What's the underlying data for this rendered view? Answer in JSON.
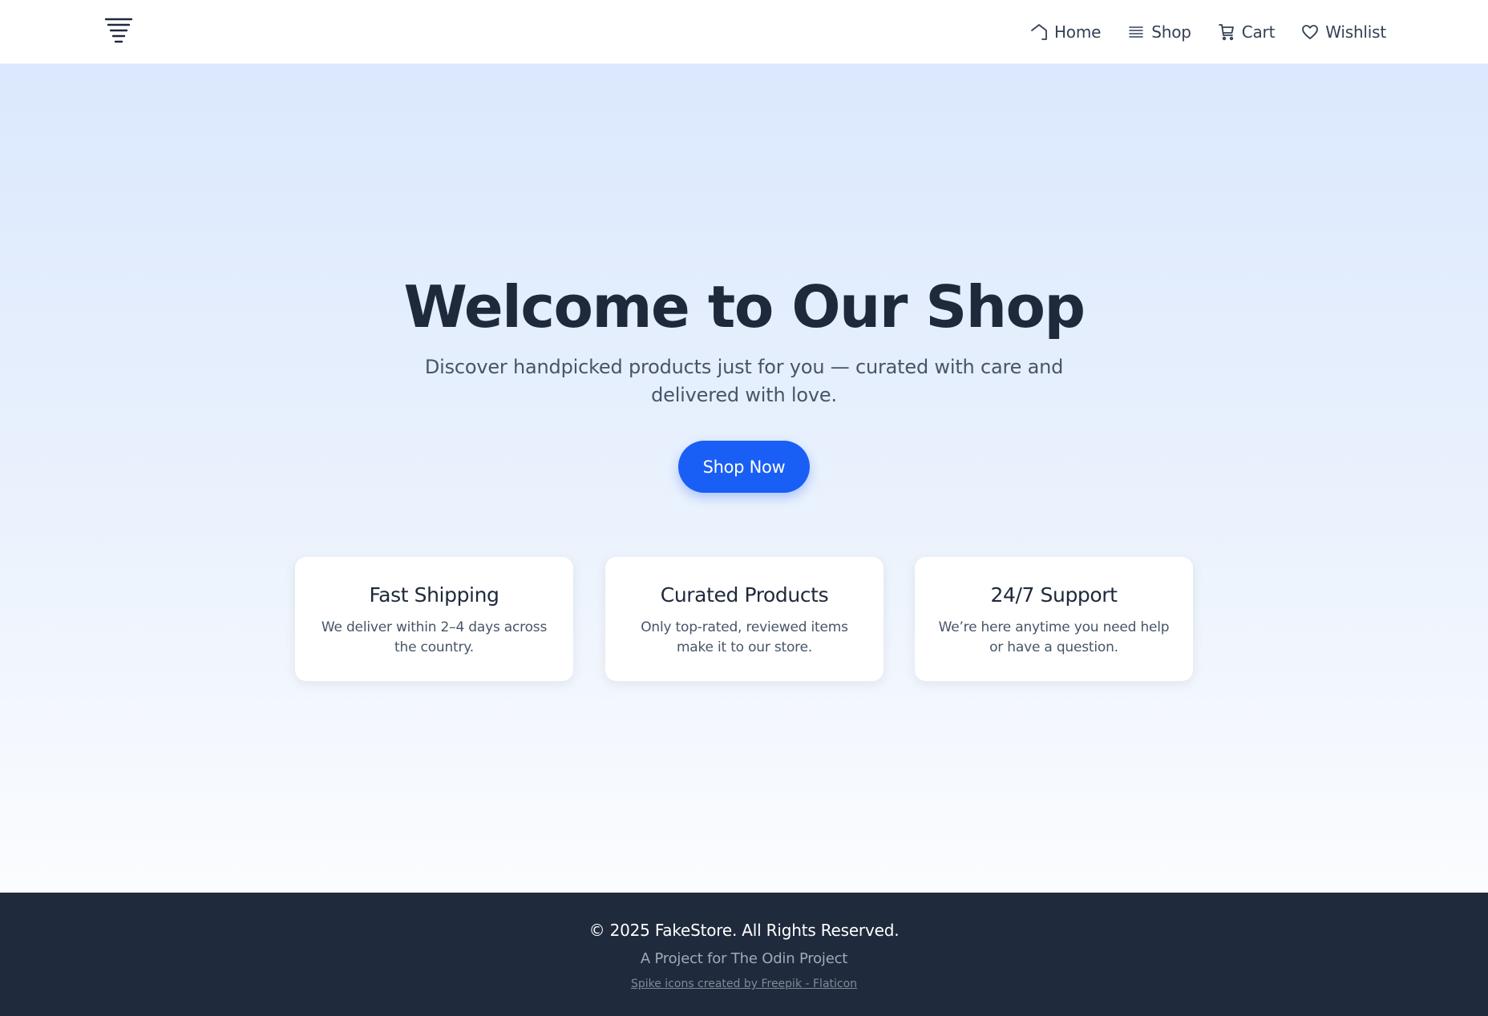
{
  "header": {
    "logo_icon": "spike-logo-icon",
    "nav": [
      {
        "label": "Home",
        "icon": "home-icon"
      },
      {
        "label": "Shop",
        "icon": "list-icon"
      },
      {
        "label": "Cart",
        "icon": "cart-icon"
      },
      {
        "label": "Wishlist",
        "icon": "heart-icon"
      }
    ]
  },
  "hero": {
    "title": "Welcome to Our Shop",
    "subtitle": "Discover handpicked products just for you — curated with care and delivered with love.",
    "cta_label": "Shop Now"
  },
  "features": [
    {
      "title": "Fast Shipping",
      "text": "We deliver within 2–4 days across the country."
    },
    {
      "title": "Curated Products",
      "text": "Only top-rated, reviewed items make it to our store."
    },
    {
      "title": "24/7 Support",
      "text": "We’re here anytime you need help or have a question."
    }
  ],
  "footer": {
    "copyright": "© 2025 FakeStore. All Rights Reserved.",
    "project": "A Project for The Odin Project",
    "credits_link": "Spike icons created by Freepik - Flaticon"
  },
  "colors": {
    "accent": "#1a5ff5",
    "text_dark": "#1e293b",
    "text_muted": "#475569",
    "footer_bg": "#1f2a3c",
    "hero_gradient_top": "#dbe8fd",
    "hero_gradient_bottom": "#fbfcfe"
  }
}
